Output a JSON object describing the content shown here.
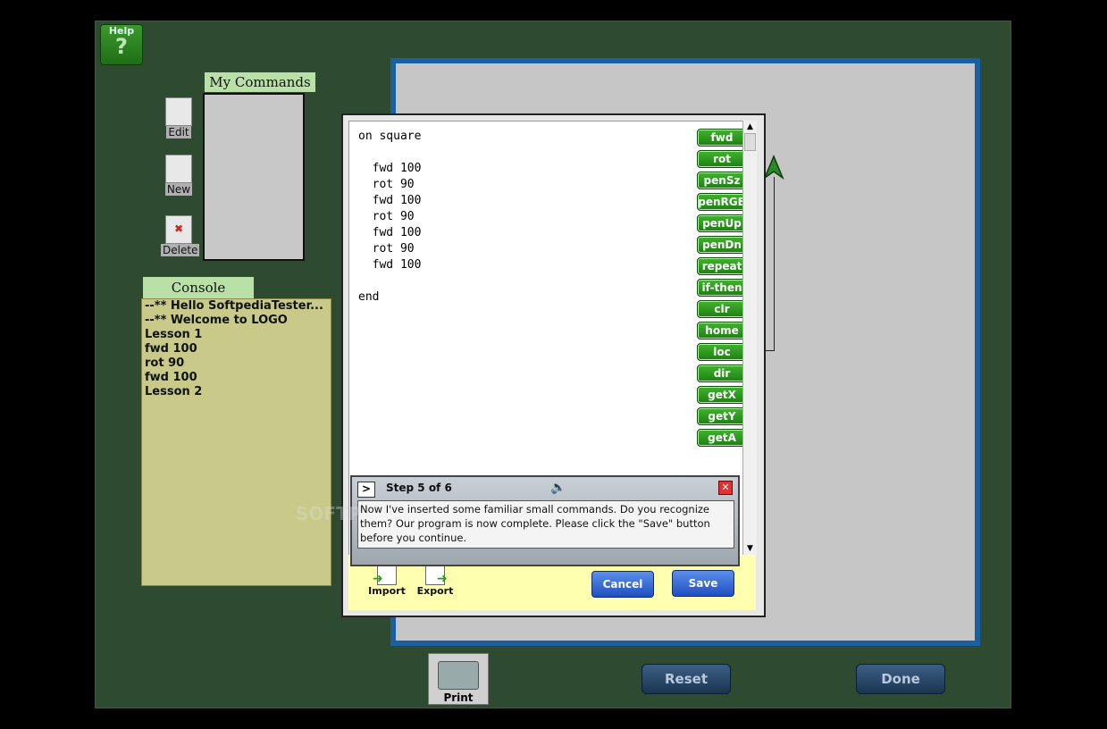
{
  "help": {
    "label": "Help",
    "glyph": "?"
  },
  "my_commands": {
    "title": "My Commands"
  },
  "side_tools": {
    "edit": "Edit",
    "new": "New",
    "delete": "Delete"
  },
  "console": {
    "title": "Console",
    "lines": [
      "--** Hello SoftpediaTester...",
      "--** Welcome to LOGO",
      "Lesson 1",
      "fwd 100",
      "rot 90",
      "fwd 100",
      "Lesson 2"
    ]
  },
  "editor": {
    "code": "on square\n\n  fwd 100\n  rot 90\n  fwd 100\n  rot 90\n  fwd 100\n  rot 90\n  fwd 100\n\nend"
  },
  "palette": [
    "fwd",
    "rot",
    "penSz",
    "penRGB",
    "penUp",
    "penDn",
    "repeat",
    "if-then",
    "clr",
    "home",
    "loc",
    "dir",
    "getX",
    "getY",
    "getA"
  ],
  "step": {
    "next": ">",
    "title": "Step 5 of 6",
    "text": "Now I've inserted some familiar small commands.  Do you recognize them?  Our program is now complete.  Please click the \"Save\" button before you continue."
  },
  "dialog_buttons": {
    "import": "Import",
    "export": "Export",
    "cancel": "Cancel",
    "save": "Save"
  },
  "bottom": {
    "print": "Print",
    "reset": "Reset",
    "done": "Done"
  },
  "watermark": "SOFTP"
}
